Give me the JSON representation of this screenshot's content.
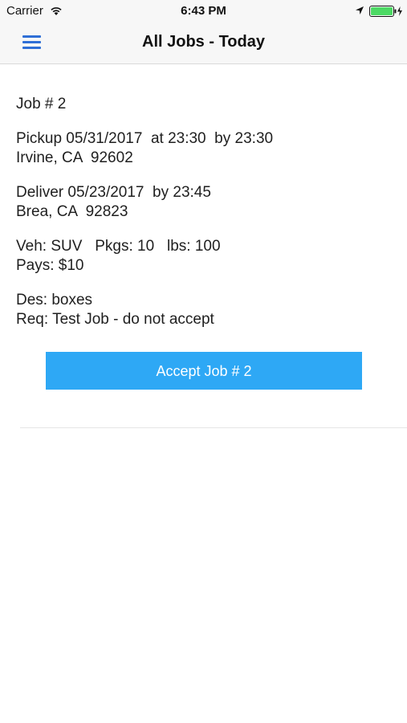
{
  "status_bar": {
    "carrier": "Carrier",
    "time": "6:43 PM",
    "icons": [
      "wifi-icon",
      "location-icon",
      "battery-icon"
    ],
    "battery_color": "#4cd964"
  },
  "nav": {
    "title": "All Jobs - Today",
    "menu_icon": "hamburger-menu-icon",
    "accent_color": "#2f6fd6"
  },
  "job": {
    "number_line": "Job # 2",
    "pickup_line": "Pickup 05/31/2017  at 23:30  by 23:30",
    "pickup_address": "Irvine, CA  92602",
    "deliver_line": "Deliver 05/23/2017  by 23:45",
    "deliver_address": "Brea, CA  92823",
    "vehicle_line": "Veh: SUV   Pkgs: 10   lbs: 100",
    "pays_line": "Pays: $10",
    "description_line": "Des: boxes",
    "requirements_line": "Req: Test Job - do not accept"
  },
  "actions": {
    "accept_label": "Accept Job # 2",
    "accept_color": "#2ea8f5"
  }
}
